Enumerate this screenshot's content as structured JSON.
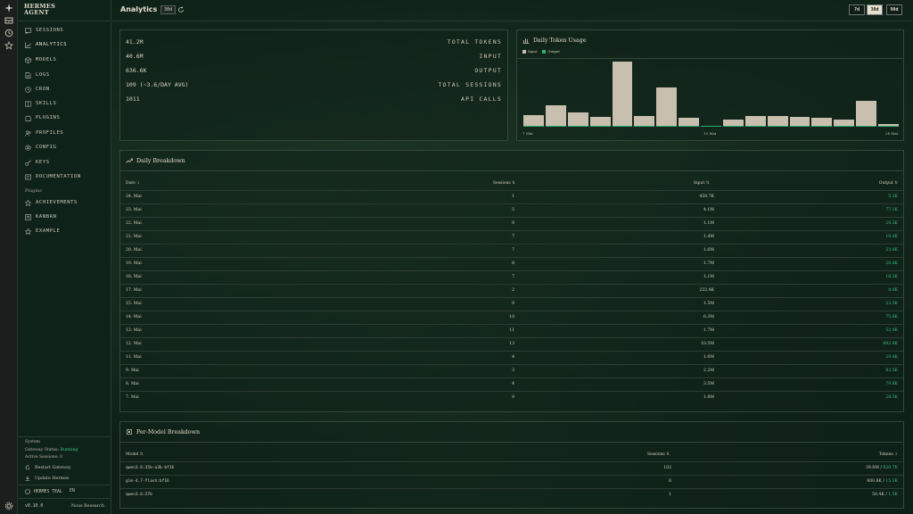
{
  "sidebar": {
    "logo_line1": "HERMES",
    "logo_line2": "AGENT",
    "nav": [
      {
        "label": "SESSIONS",
        "icon": "chat-icon"
      },
      {
        "label": "ANALYTICS",
        "icon": "chart-icon"
      },
      {
        "label": "MODELS",
        "icon": "cube-icon"
      },
      {
        "label": "LOGS",
        "icon": "file-icon"
      },
      {
        "label": "CRON",
        "icon": "clock-icon"
      },
      {
        "label": "SKILLS",
        "icon": "book-icon"
      },
      {
        "label": "PLUGINS",
        "icon": "puzzle-icon"
      },
      {
        "label": "PROFILES",
        "icon": "users-icon"
      },
      {
        "label": "CONFIG",
        "icon": "gear-icon"
      },
      {
        "label": "KEYS",
        "icon": "key-icon"
      },
      {
        "label": "DOCUMENTATION",
        "icon": "doc-icon"
      }
    ],
    "plugins_label": "Plugins",
    "plugins": [
      {
        "label": "ACHIEVEMENTS",
        "icon": "star-icon"
      },
      {
        "label": "KANBAN",
        "icon": "kanban-icon"
      },
      {
        "label": "EXAMPLE",
        "icon": "star-icon"
      }
    ],
    "system_label": "System",
    "gateway_status_label": "Gateway Status:",
    "gateway_status_value": "Running",
    "active_sessions": "Active Sessions: 0",
    "restart_gateway": "Restart Gateway",
    "update_hermes": "Update Hermes",
    "theme_name": "HERMES TEAL",
    "language": "EN",
    "version": "v0.10.0",
    "vendor": "Nous Research"
  },
  "header": {
    "title": "Analytics",
    "period_badge": "30d",
    "periods": [
      "7d",
      "30d",
      "90d"
    ],
    "selected_period": "30d"
  },
  "stats": [
    {
      "value": "41.2M",
      "label": "TOTAL TOKENS"
    },
    {
      "value": "40.6M",
      "label": "INPUT"
    },
    {
      "value": "636.6K",
      "label": "OUTPUT"
    },
    {
      "value": "109 (~3.6/DAY AVG)",
      "label": "TOTAL SESSIONS"
    },
    {
      "value": "1011",
      "label": "API CALLS"
    }
  ],
  "token_chart": {
    "title": "Daily Token Usage",
    "legend_input": "Input",
    "legend_output": "Output",
    "x_labels": [
      "7 Mai",
      "15 Mai",
      "24 Mai"
    ],
    "colors": {
      "input": "#c9bfae",
      "output": "#2fae74"
    }
  },
  "chart_data": {
    "type": "bar",
    "title": "Daily Token Usage",
    "categories": [
      "7 Mai",
      "8 Mai",
      "9 Mai",
      "11 Mai",
      "12 Mai",
      "13 Mai",
      "14 Mai",
      "15 Mai",
      "16 Mai",
      "17 Mai",
      "18 Mai",
      "19 Mai",
      "20 Mai",
      "21 Mai",
      "22 Mai",
      "23 Mai",
      "24 Mai"
    ],
    "series": [
      {
        "name": "Input",
        "values": [
          1.8,
          3.5,
          2.3,
          1.6,
          10.5,
          1.7,
          6.3,
          1.5,
          0.2,
          1.1,
          1.7,
          1.7,
          1.6,
          1.4,
          1.1,
          4.1,
          0.45
        ]
      },
      {
        "name": "Output",
        "values": [
          0.03,
          0.08,
          0.08,
          0.03,
          0.8,
          0.05,
          0.08,
          0.02,
          0.01,
          0.02,
          0.02,
          0.03,
          0.02,
          0.02,
          0.02,
          0.01,
          0.01
        ]
      }
    ],
    "y_max": 10.5
  },
  "daily": {
    "title": "Daily Breakdown",
    "headers": {
      "date": "Date",
      "sessions": "Sessions",
      "input": "Input",
      "output": "Output"
    },
    "rows": [
      {
        "date": "24. Mai",
        "sessions": "1",
        "input": "450.7K",
        "output": "5.3K"
      },
      {
        "date": "23. Mai",
        "sessions": "5",
        "input": "4.1M",
        "output": "77.1K"
      },
      {
        "date": "22. Mai",
        "sessions": "9",
        "input": "1.1M",
        "output": "20.5K"
      },
      {
        "date": "21. Mai",
        "sessions": "7",
        "input": "1.4M",
        "output": "19.4K"
      },
      {
        "date": "20. Mai",
        "sessions": "7",
        "input": "1.6M",
        "output": "23.0K"
      },
      {
        "date": "19. Mai",
        "sessions": "8",
        "input": "1.7M",
        "output": "26.4K"
      },
      {
        "date": "18. Mai",
        "sessions": "7",
        "input": "1.1M",
        "output": "18.3K"
      },
      {
        "date": "17. Mai",
        "sessions": "2",
        "input": "222.4K",
        "output": "8.0K"
      },
      {
        "date": "15. Mai",
        "sessions": "9",
        "input": "1.5M",
        "output": "23.5K"
      },
      {
        "date": "14. Mai",
        "sessions": "10",
        "input": "6.3M",
        "output": "75.6K"
      },
      {
        "date": "13. Mai",
        "sessions": "11",
        "input": "1.7M",
        "output": "52.9K"
      },
      {
        "date": "12. Mai",
        "sessions": "13",
        "input": "10.5M",
        "output": "802.6K"
      },
      {
        "date": "11. Mai",
        "sessions": "4",
        "input": "1.6M",
        "output": "29.4K"
      },
      {
        "date": "9. Mai",
        "sessions": "3",
        "input": "2.2M",
        "output": "83.5K"
      },
      {
        "date": "8. Mai",
        "sessions": "4",
        "input": "3.5M",
        "output": "79.6K"
      },
      {
        "date": "7. Mai",
        "sessions": "9",
        "input": "1.8M",
        "output": "28.5K"
      }
    ]
  },
  "per_model": {
    "title": "Per-Model Breakdown",
    "headers": {
      "model": "Model",
      "sessions": "Sessions",
      "tokens": "Tokens"
    },
    "rows": [
      {
        "model": "qwen3.6:35b-a3b-bf16",
        "sessions": "102",
        "tokens_in": "39.8M",
        "tokens_out": "620.7K"
      },
      {
        "model": "glm-4.7-flash:bf16",
        "sessions": "6",
        "tokens_in": "800.8K",
        "tokens_out": "15.1K"
      },
      {
        "model": "qwen3.6:27b",
        "sessions": "1",
        "tokens_in": "50.4K",
        "tokens_out": "1.5K"
      }
    ]
  }
}
